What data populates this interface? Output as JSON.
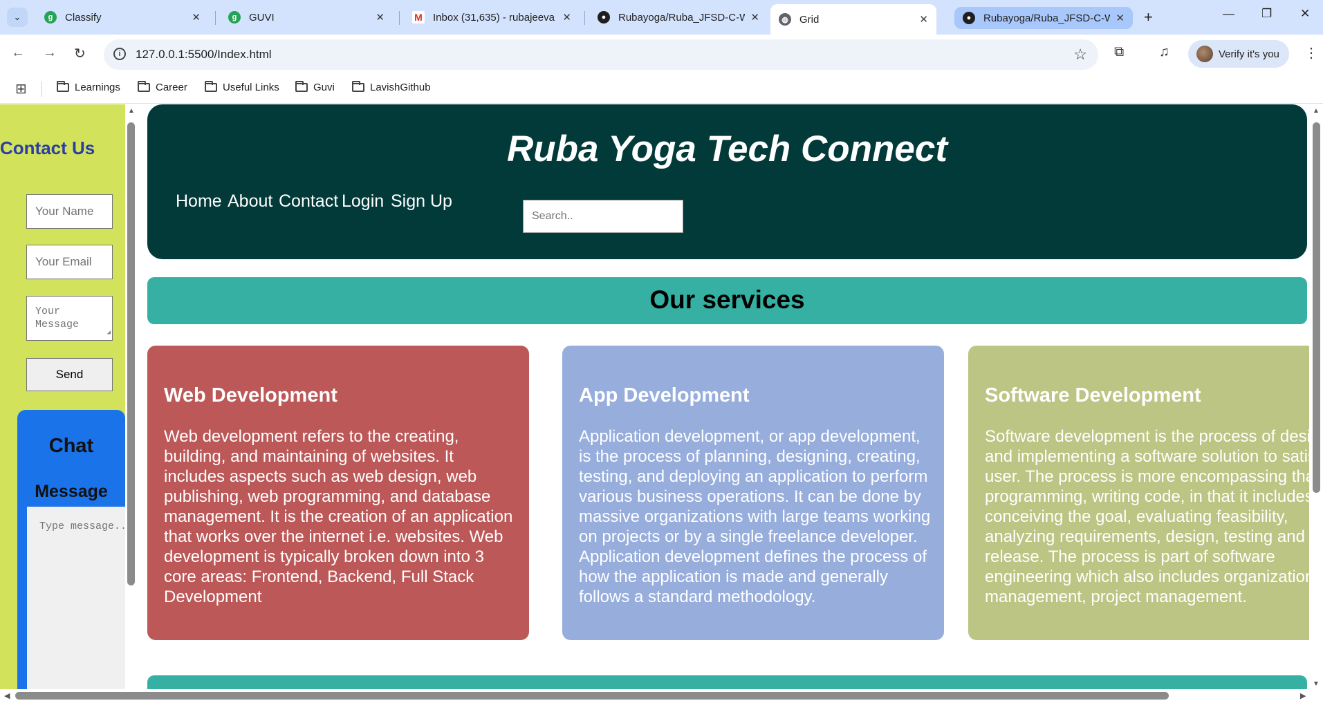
{
  "browser": {
    "tabs": [
      {
        "title": "Classify",
        "icon": "guvi-icon"
      },
      {
        "title": "GUVI",
        "icon": "guvi-icon"
      },
      {
        "title": "Inbox (31,635) - rubajeeva",
        "icon": "gmail-icon"
      },
      {
        "title": "Rubayoga/Ruba_JFSD-C-W",
        "icon": "github-icon"
      },
      {
        "title": "Grid",
        "icon": "globe-icon"
      },
      {
        "title": "Rubayoga/Ruba_JFSD-C-W",
        "icon": "github-icon"
      }
    ],
    "url": "127.0.0.1:5500/Index.html",
    "profile_label": "Verify it's you",
    "bookmarks": [
      "Learnings",
      "Career",
      "Useful Links",
      "Guvi",
      "LavishGithub"
    ]
  },
  "sidebar": {
    "title": "Contact Us",
    "name_placeholder": "Your Name",
    "email_placeholder": "Your Email",
    "message_placeholder_line1": "Your",
    "message_placeholder_line2": "Message",
    "send_label": "Send",
    "chat_title": "Chat",
    "chat_subtitle": "Message",
    "chat_placeholder": "Type message.."
  },
  "header": {
    "site_title": "Ruba Yoga Tech Connect",
    "nav": [
      "Home",
      "About",
      "Contact",
      "Login",
      "Sign Up"
    ],
    "search_placeholder": "Search.."
  },
  "services": {
    "title": "Our services",
    "cards": [
      {
        "title": "Web Development",
        "body": "Web development refers to the creating, building, and maintaining of websites. It includes aspects such as web design, web publishing, web programming, and database management. It is the creation of an application that works over the internet i.e. websites. Web development is typically broken down into 3 core areas: Frontend, Backend, Full Stack Development",
        "color": "#bc5858"
      },
      {
        "title": "App Development",
        "body": "Application development, or app development, is the process of planning, designing, creating, testing, and deploying an application to perform various business operations. It can be done by massive organizations with large teams working on projects or by a single freelance developer. Application development defines the process of how the application is made and generally follows a standard methodology.",
        "color": "#97addc"
      },
      {
        "title": "Software Development",
        "body": "Software development is the process of designing and implementing a software solution to satisfy a user. The process is more encompassing than programming, writing code, in that it includes conceiving the goal, evaluating feasibility, analyzing requirements, design, testing and release. The process is part of software engineering which also includes organizational management, project management.",
        "color": "#bcc584"
      }
    ]
  },
  "colors": {
    "header_bg": "#023a3a",
    "services_bar": "#35b0a3",
    "sidebar_bg": "#d2e25b",
    "chat_bg": "#1a73e8"
  }
}
